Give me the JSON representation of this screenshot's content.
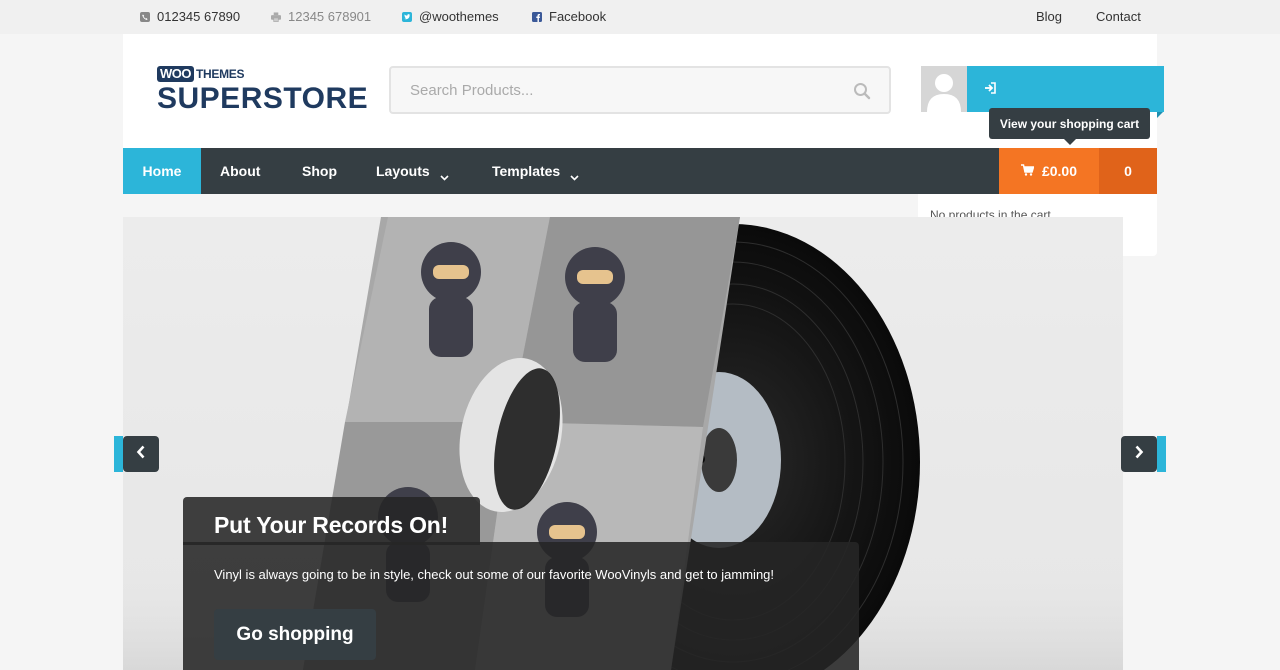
{
  "colors": {
    "accent": "#2cb5d9",
    "nav_bg": "#353e43",
    "cart_orange": "#f47523",
    "cart_orange_dark": "#e0631a",
    "brand_navy": "#1f3a5f"
  },
  "topbar": {
    "phone": {
      "icon": "phone-icon",
      "text": "012345 67890"
    },
    "fax": {
      "icon": "printer-icon",
      "text": "12345 678901"
    },
    "twitter": {
      "icon": "twitter-icon",
      "text": "@woothemes"
    },
    "facebook": {
      "icon": "facebook-icon",
      "text": "Facebook"
    },
    "links": [
      "Blog",
      "Contact"
    ]
  },
  "logo": {
    "woo": "WOO",
    "themes": "THEMES",
    "name": "SUPERSTORE"
  },
  "search": {
    "placeholder": "Search Products...",
    "value": ""
  },
  "account": {
    "tooltip": "View your shopping cart"
  },
  "nav": {
    "items": [
      {
        "label": "Home",
        "active": true
      },
      {
        "label": "About"
      },
      {
        "label": "Shop"
      },
      {
        "label": "Layouts",
        "dropdown": true
      },
      {
        "label": "Templates",
        "dropdown": true
      }
    ]
  },
  "cart": {
    "amount": "£0.00",
    "count": "0",
    "empty_text": "No products in the cart."
  },
  "slide": {
    "title": "Put Your Records On!",
    "text": "Vinyl is always going to be in style, check out some of our favorite WooVinyls and get to jamming!",
    "button": "Go shopping"
  }
}
